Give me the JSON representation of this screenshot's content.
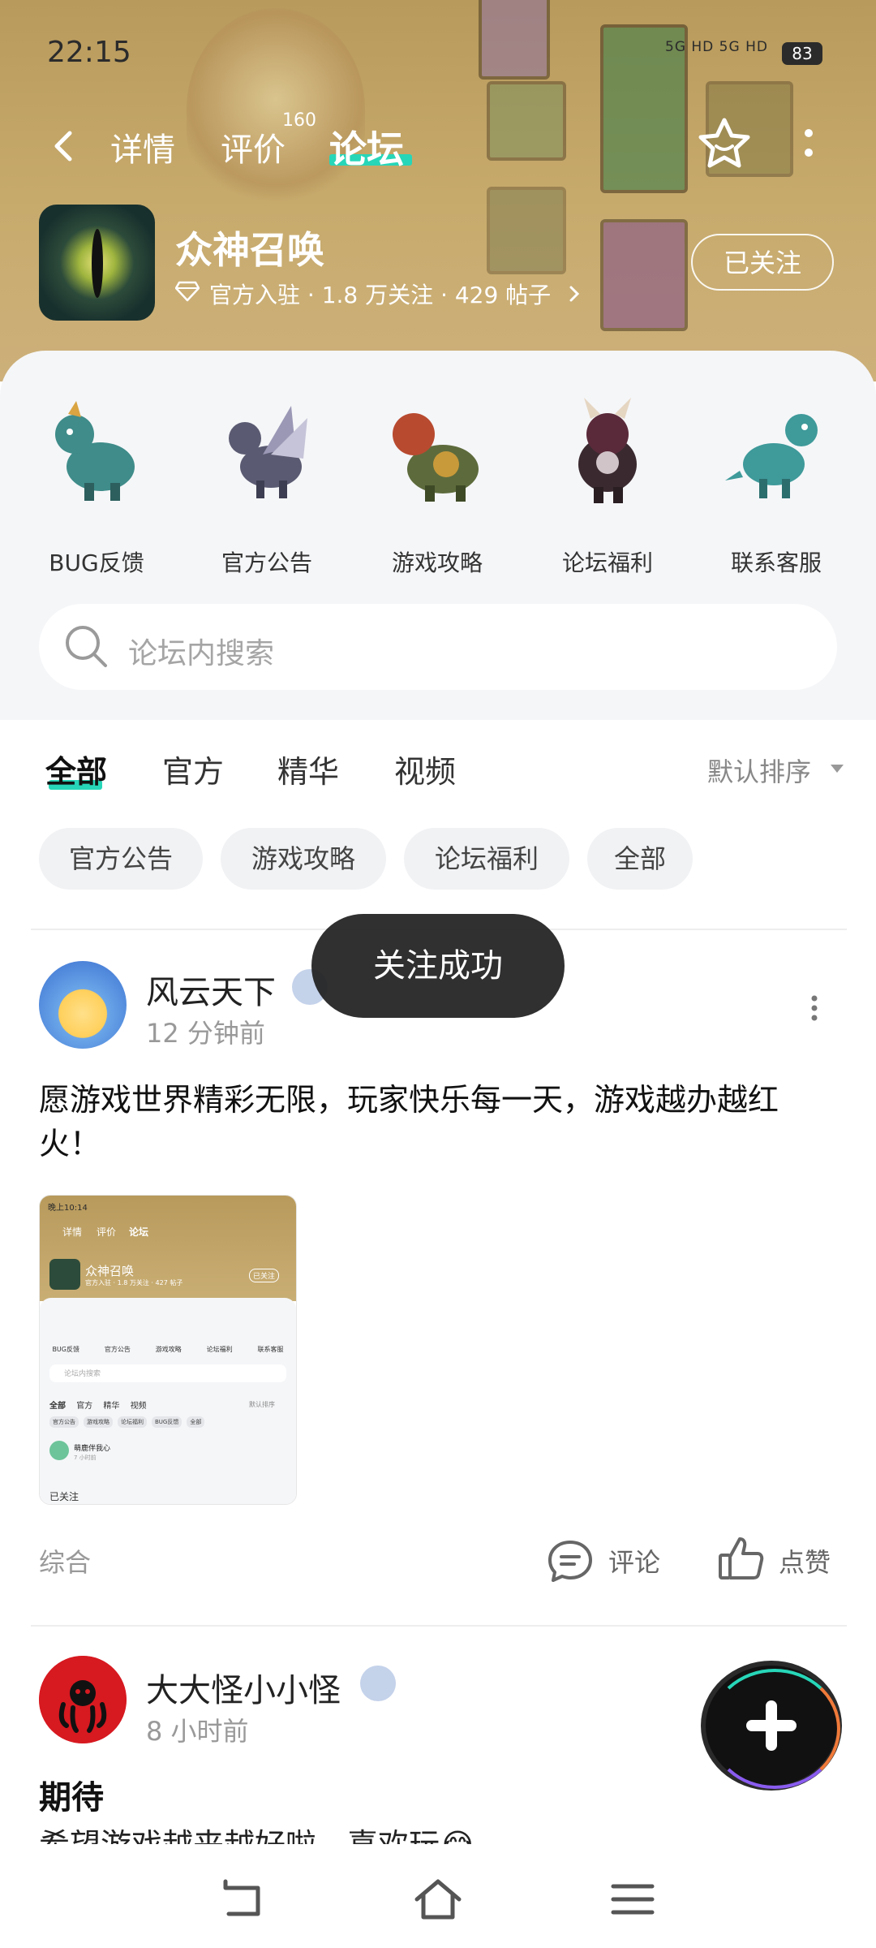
{
  "status": {
    "time": "22:15",
    "network": "5G HD 5G HD",
    "battery": "83"
  },
  "nav": {
    "tabs": [
      {
        "label": "详情"
      },
      {
        "label": "评价"
      },
      {
        "label": "论坛"
      }
    ],
    "review_count": "160"
  },
  "app": {
    "name": "众神召唤",
    "meta": "官方入驻 · 1.8 万关注 · 429 帖子",
    "follow_label": "已关注"
  },
  "categories": [
    {
      "label": "BUG反馈",
      "icon": "dragon-bug-icon",
      "color": "#3f8c8a"
    },
    {
      "label": "官方公告",
      "icon": "dragon-notice-icon",
      "color": "#6b6a86"
    },
    {
      "label": "游戏攻略",
      "icon": "dragon-guide-icon",
      "color": "#b84a30"
    },
    {
      "label": "论坛福利",
      "icon": "dragon-welfare-icon",
      "color": "#5a2a3a"
    },
    {
      "label": "联系客服",
      "icon": "dragon-service-icon",
      "color": "#3f9a9a"
    }
  ],
  "search": {
    "placeholder": "论坛内搜索"
  },
  "filter_tabs": [
    {
      "label": "全部"
    },
    {
      "label": "官方"
    },
    {
      "label": "精华"
    },
    {
      "label": "视频"
    }
  ],
  "sort": {
    "label": "默认排序"
  },
  "chips": [
    {
      "label": "官方公告"
    },
    {
      "label": "游戏攻略"
    },
    {
      "label": "论坛福利"
    },
    {
      "label": "全部"
    }
  ],
  "toast": "关注成功",
  "posts": [
    {
      "author": "风云天下",
      "time": "12 分钟前",
      "text": "愿游戏世界精彩无限，玩家快乐每一天，游戏越办越红火！",
      "category": "综合",
      "comment_label": "评论",
      "like_label": "点赞",
      "thumbnail": {
        "status_time": "晚上10:14",
        "nav": {
          "tabs": [
            "详情",
            "评价",
            "论坛"
          ],
          "follow_label": "已关注"
        },
        "app_name": "众神召唤",
        "meta": "官方入驻 · 1.8 万关注 · 427 帖子",
        "categories": [
          "BUG反馈",
          "官方公告",
          "游戏攻略",
          "论坛福利",
          "联系客服"
        ],
        "search_placeholder": "论坛内搜索",
        "filter_tabs": [
          "全部",
          "官方",
          "精华",
          "视频"
        ],
        "sort_label": "默认排序",
        "chips": [
          "官方公告",
          "游戏攻略",
          "论坛福利",
          "BUG反馈",
          "全部"
        ],
        "post": {
          "author": "萌鹿伴我心",
          "time": "7 小时前"
        },
        "footer": "已关注"
      }
    },
    {
      "author": "大大怪小小怪",
      "time": "8 小时前",
      "title": "期待",
      "text": "希望游戏越来越好啦，喜欢玩😂"
    }
  ],
  "colors": {
    "accent": "#27d6b8",
    "hero_bg": "#c3a66a",
    "sheet_bg": "#f5f6f8"
  }
}
